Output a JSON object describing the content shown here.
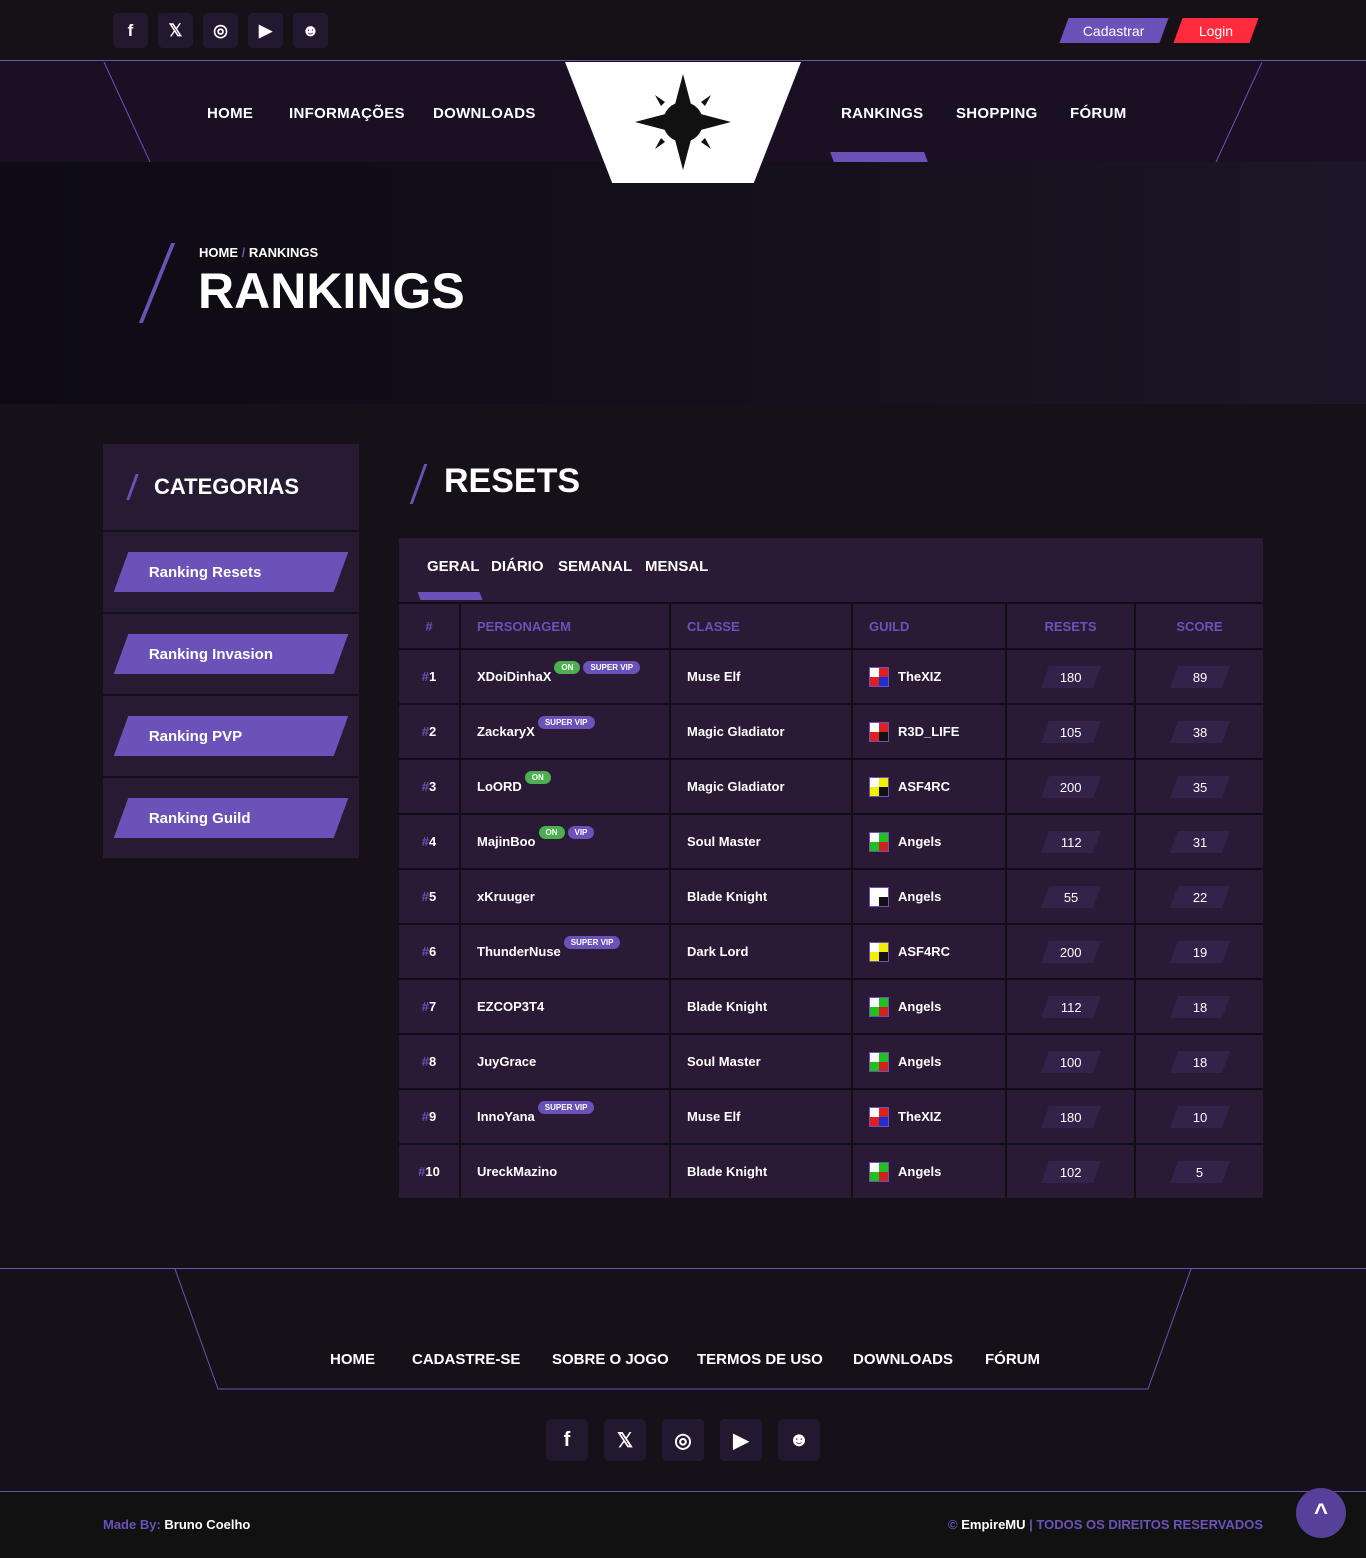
{
  "header": {
    "social": [
      {
        "icon": "facebook-icon",
        "glyph": "f"
      },
      {
        "icon": "x-icon",
        "glyph": "𝕏"
      },
      {
        "icon": "instagram-icon",
        "glyph": "◎"
      },
      {
        "icon": "youtube-icon",
        "glyph": "▶"
      },
      {
        "icon": "discord-icon",
        "glyph": "☻"
      }
    ],
    "register": "Cadastrar",
    "login": "Login",
    "nav_left": [
      "HOME",
      "INFORMAÇÕES",
      "DOWNLOADS"
    ],
    "nav_right": [
      "RANKINGS",
      "SHOPPING",
      "FÓRUM"
    ]
  },
  "hero": {
    "crumb_home": "HOME",
    "crumb_sep": "/",
    "crumb_current": "RANKINGS",
    "title": "RANKINGS"
  },
  "sidebar": {
    "title": "CATEGORIAS",
    "items": [
      "Ranking Resets",
      "Ranking Invasion",
      "Ranking PVP",
      "Ranking Guild"
    ]
  },
  "main": {
    "title": "RESETS",
    "tabs": [
      "GERAL",
      "DIÁRIO",
      "SEMANAL",
      "MENSAL"
    ],
    "columns": [
      "#",
      "PERSONAGEM",
      "CLASSE",
      "GUILD",
      "RESETS",
      "SCORE"
    ],
    "rows": [
      {
        "rank": "1",
        "name": "XDoiDinhaX",
        "on": "ON",
        "vip": "SUPER VIP",
        "class": "Muse Elf",
        "guild": "TheXIZ",
        "c1": "#e02020",
        "c2": "#2030d0",
        "resets": "180",
        "score": "89"
      },
      {
        "rank": "2",
        "name": "ZackaryX",
        "on": "",
        "vip": "SUPER VIP",
        "class": "Magic Gladiator",
        "guild": "R3D_LIFE",
        "c1": "#e02020",
        "c2": "#111111",
        "resets": "105",
        "score": "38"
      },
      {
        "rank": "3",
        "name": "LoORD",
        "on": "ON",
        "vip": "",
        "class": "Magic Gladiator",
        "guild": "ASF4RC",
        "c1": "#f0f000",
        "c2": "#111111",
        "resets": "200",
        "score": "35"
      },
      {
        "rank": "4",
        "name": "MajinBoo",
        "on": "ON",
        "vip": "VIP",
        "class": "Soul Master",
        "guild": "Angels",
        "c1": "#20c020",
        "c2": "#d02020",
        "resets": "112",
        "score": "31"
      },
      {
        "rank": "5",
        "name": "xKruuger",
        "on": "",
        "vip": "",
        "class": "Blade Knight",
        "guild": "Angels",
        "c1": "#ffffff",
        "c2": "#111111",
        "resets": "55",
        "score": "22"
      },
      {
        "rank": "6",
        "name": "ThunderNuse",
        "on": "",
        "vip": "SUPER VIP",
        "class": "Dark Lord",
        "guild": "ASF4RC",
        "c1": "#f0f000",
        "c2": "#111111",
        "resets": "200",
        "score": "19"
      },
      {
        "rank": "7",
        "name": "EZCOP3T4",
        "on": "",
        "vip": "",
        "class": "Blade Knight",
        "guild": "Angels",
        "c1": "#20c020",
        "c2": "#d02020",
        "resets": "112",
        "score": "18"
      },
      {
        "rank": "8",
        "name": "JuyGrace",
        "on": "",
        "vip": "",
        "class": "Soul Master",
        "guild": "Angels",
        "c1": "#20c020",
        "c2": "#d02020",
        "resets": "100",
        "score": "18"
      },
      {
        "rank": "9",
        "name": "InnoYana",
        "on": "",
        "vip": "SUPER VIP",
        "class": "Muse Elf",
        "guild": "TheXIZ",
        "c1": "#e02020",
        "c2": "#2030d0",
        "resets": "180",
        "score": "10"
      },
      {
        "rank": "10",
        "name": "UreckMazino",
        "on": "",
        "vip": "",
        "class": "Blade Knight",
        "guild": "Angels",
        "c1": "#20c020",
        "c2": "#d02020",
        "resets": "102",
        "score": "5"
      }
    ]
  },
  "footer": {
    "links": [
      "HOME",
      "CADASTRE-SE",
      "SOBRE O JOGO",
      "TERMOS DE USO",
      "DOWNLOADS",
      "FÓRUM"
    ],
    "made_by_label": "Made By:",
    "made_by": "Bruno Coelho",
    "copyright_symbol": "©",
    "brand": "EmpireMU",
    "rights": "| TODOS OS DIREITOS RESERVADOS",
    "top_glyph": "^"
  },
  "colors": {
    "accent": "#6a52b8",
    "login": "#ff2a3d",
    "on": "#4caf50"
  }
}
